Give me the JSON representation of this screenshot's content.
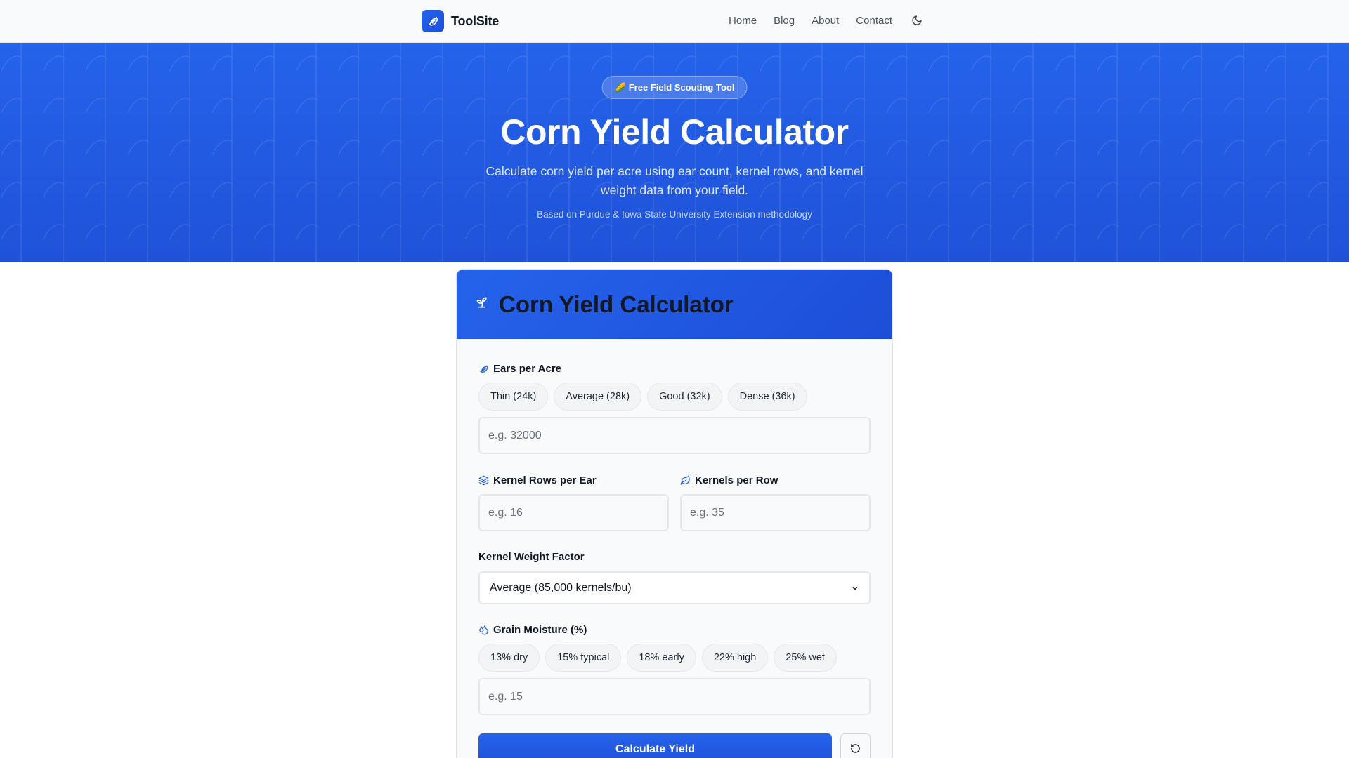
{
  "navbar": {
    "brand": "ToolSite",
    "links": [
      "Home",
      "Blog",
      "About",
      "Contact"
    ]
  },
  "hero": {
    "badge_icon": "🌽",
    "badge": "Free Field Scouting Tool",
    "title": "Corn Yield Calculator",
    "subtitle": "Calculate corn yield per acre using ear count, kernel rows, and kernel weight data from your field.",
    "note": "Based on Purdue & Iowa State University Extension methodology"
  },
  "calculator": {
    "title": "Corn Yield Calculator",
    "ears": {
      "label": "Ears per Acre",
      "chips": [
        "Thin (24k)",
        "Average (28k)",
        "Good (32k)",
        "Dense (36k)"
      ],
      "placeholder": "e.g. 32000"
    },
    "rows": {
      "label": "Kernel Rows per Ear",
      "placeholder": "e.g. 16"
    },
    "kernels": {
      "label": "Kernels per Row",
      "placeholder": "e.g. 35"
    },
    "weight": {
      "label": "Kernel Weight Factor",
      "selected": "Average (85,000 kernels/bu)"
    },
    "moisture": {
      "label": "Grain Moisture (%)",
      "chips": [
        "13% dry",
        "15% typical",
        "18% early",
        "22% high",
        "25% wet"
      ],
      "placeholder": "e.g. 15"
    },
    "calculate_label": "Calculate Yield"
  },
  "colors": {
    "accent": "#2563eb",
    "accent_dark": "#1d4ed8"
  }
}
